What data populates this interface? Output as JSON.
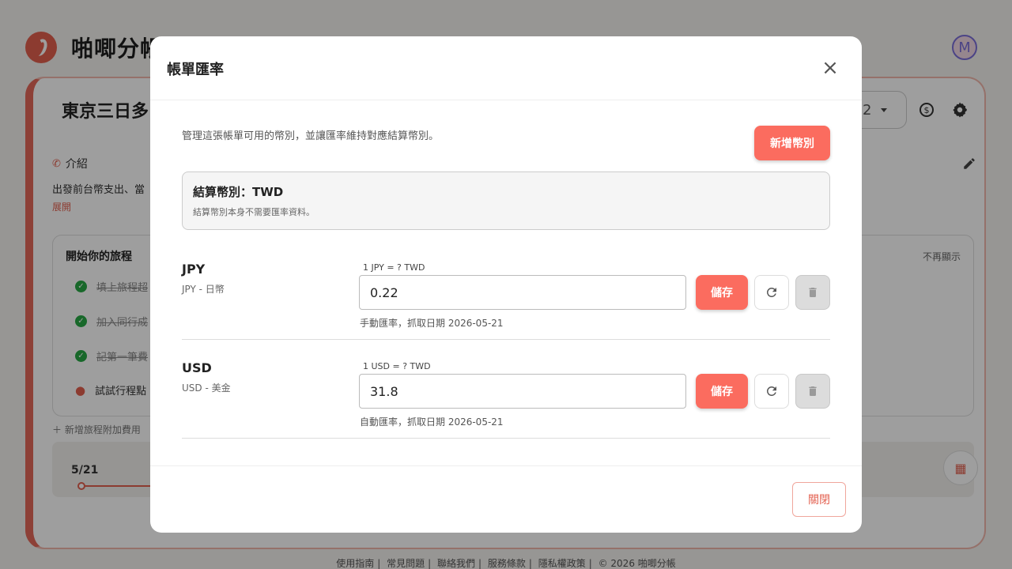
{
  "app": {
    "brand": "啪唧分帳",
    "avatar_initial": "M"
  },
  "background": {
    "trip_title": "東京三日多",
    "selector_fragment": "2",
    "intro": {
      "heading": "介紹",
      "text": "出發前台幣支出、當",
      "expand": "展開"
    },
    "guide": {
      "heading": "開始你的旅程",
      "dismiss": "不再顯示",
      "items": [
        {
          "label": "填上旅程超",
          "done": true
        },
        {
          "label": "加入同行成",
          "done": true
        },
        {
          "label": "記第一筆費",
          "done": true
        },
        {
          "label": "試試行程點",
          "done": false
        }
      ]
    },
    "add_fee": "新增旅程附加費用",
    "day_label": "5/21",
    "footer": [
      "使用指南",
      "常見問題",
      "聯絡我們",
      "服務條款",
      "隱私權政策",
      "© 2026 啪唧分帳"
    ]
  },
  "modal": {
    "title": "帳單匯率",
    "close_symbol": "×",
    "description": "管理這張帳單可用的幣別，並讓匯率維持對應結算幣別。",
    "add_button": "新增幣別",
    "settlement": {
      "title": "結算幣別：TWD",
      "subtitle": "結算幣別本身不需要匯率資料。"
    },
    "currencies": [
      {
        "code": "JPY",
        "name": "JPY - 日幣",
        "rate_label": "1 JPY = ? TWD",
        "value": "0.22",
        "meta": "手動匯率，抓取日期 2026-05-21",
        "save": "儲存"
      },
      {
        "code": "USD",
        "name": "USD - 美金",
        "rate_label": "1 USD = ? TWD",
        "value": "31.8",
        "meta": "自動匯率，抓取日期 2026-05-21",
        "save": "儲存"
      }
    ],
    "footer_close": "關閉"
  }
}
